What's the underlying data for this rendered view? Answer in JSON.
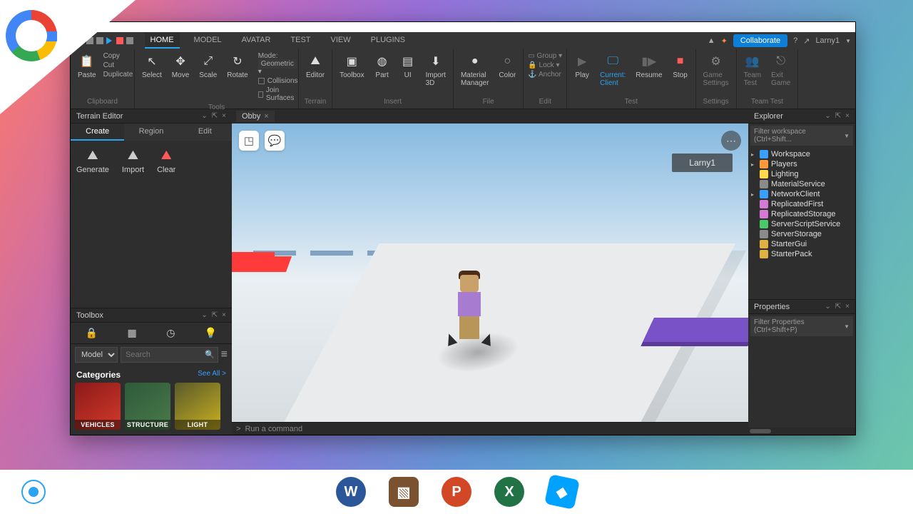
{
  "menubar": {
    "tabs": [
      "HOME",
      "MODEL",
      "AVATAR",
      "TEST",
      "VIEW",
      "PLUGINS"
    ],
    "active": "HOME",
    "collaborate": "Collaborate",
    "username": "Larny1"
  },
  "ribbon": {
    "clipboard": {
      "paste": "Paste",
      "copy": "Copy",
      "cut": "Cut",
      "duplicate": "Duplicate",
      "label": "Clipboard"
    },
    "tools": {
      "select": "Select",
      "move": "Move",
      "scale": "Scale",
      "rotate": "Rotate",
      "mode_label": "Mode:",
      "mode_value": "Geometric",
      "collisions": "Collisions",
      "join": "Join Surfaces",
      "label": "Tools"
    },
    "terrain": {
      "editor": "Editor",
      "label": "Terrain"
    },
    "insert": {
      "toolbox": "Toolbox",
      "part": "Part",
      "ui": "UI",
      "import": "Import\n3D",
      "label": "Insert"
    },
    "file": {
      "material": "Material\nManager",
      "color": "Color",
      "label": "File"
    },
    "edit": {
      "group": "Group",
      "lock": "Lock",
      "anchor": "Anchor",
      "label": "Edit"
    },
    "test": {
      "play": "Play",
      "current": "Current:\nClient",
      "resume": "Resume",
      "stop": "Stop",
      "label": "Test"
    },
    "settings": {
      "game": "Game\nSettings",
      "label": "Settings"
    },
    "teamtest": {
      "team": "Team\nTest",
      "exit": "Exit\nGame",
      "label": "Team Test"
    }
  },
  "terrain_panel": {
    "title": "Terrain Editor",
    "tabs": [
      "Create",
      "Region",
      "Edit"
    ],
    "active": "Create",
    "buttons": {
      "generate": "Generate",
      "import": "Import",
      "clear": "Clear"
    }
  },
  "toolbox": {
    "title": "Toolbox",
    "dropdown": "Models",
    "search_placeholder": "Search",
    "categories_label": "Categories",
    "see_all": "See All >",
    "cats": [
      "VEHICLES",
      "STRUCTURE",
      "LIGHT"
    ]
  },
  "doctab": "Obby",
  "viewport": {
    "nametag": "Larny1"
  },
  "command": {
    "placeholder": "Run a command",
    "prompt": ">"
  },
  "explorer": {
    "title": "Explorer",
    "filter": "Filter workspace (Ctrl+Shift...",
    "items": [
      {
        "name": "Workspace",
        "color": "#3aa0ff",
        "expand": true
      },
      {
        "name": "Players",
        "color": "#ff9a3a",
        "expand": true
      },
      {
        "name": "Lighting",
        "color": "#ffd94a"
      },
      {
        "name": "MaterialService",
        "color": "#8a8a8a"
      },
      {
        "name": "NetworkClient",
        "color": "#3aa0ff",
        "expand": true
      },
      {
        "name": "ReplicatedFirst",
        "color": "#d47ad4"
      },
      {
        "name": "ReplicatedStorage",
        "color": "#d47ad4"
      },
      {
        "name": "ServerScriptService",
        "color": "#4ac96a"
      },
      {
        "name": "ServerStorage",
        "color": "#8a8a8a"
      },
      {
        "name": "StarterGui",
        "color": "#e0b040"
      },
      {
        "name": "StarterPack",
        "color": "#e0b040"
      }
    ]
  },
  "properties": {
    "title": "Properties",
    "filter": "Filter Properties (Ctrl+Shift+P)"
  },
  "taskbar_apps": [
    "W",
    "▧",
    "P",
    "X",
    "◆"
  ]
}
